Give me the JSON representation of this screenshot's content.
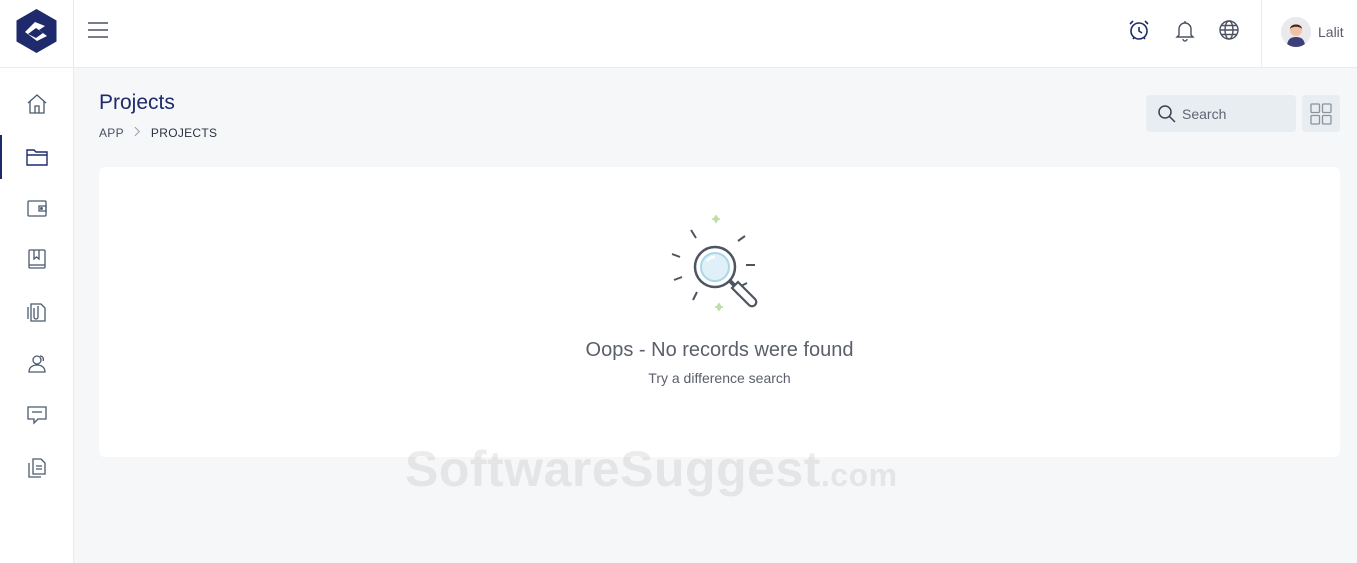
{
  "sidebar": {
    "items": [
      {
        "name": "home",
        "icon": "home-icon",
        "active": false
      },
      {
        "name": "projects",
        "icon": "folder-icon",
        "active": true
      },
      {
        "name": "wallet",
        "icon": "wallet-icon",
        "active": false
      },
      {
        "name": "bookmarks",
        "icon": "book-icon",
        "active": false
      },
      {
        "name": "documents",
        "icon": "clip-document-icon",
        "active": false
      },
      {
        "name": "users",
        "icon": "users-icon",
        "active": false
      },
      {
        "name": "messages",
        "icon": "chat-icon",
        "active": false
      },
      {
        "name": "files",
        "icon": "files-icon",
        "active": false
      }
    ]
  },
  "header": {
    "icons": [
      "alarm-clock-icon",
      "bell-icon",
      "globe-icon"
    ],
    "user_name": "Lalit"
  },
  "page": {
    "title": "Projects",
    "breadcrumb": [
      "APP",
      "PROJECTS"
    ]
  },
  "search": {
    "placeholder": "Search"
  },
  "empty_state": {
    "title": "Oops - No records were found",
    "subtitle": "Try a difference search"
  },
  "watermark": {
    "main": "SoftwareSuggest",
    "suffix": ".com"
  },
  "colors": {
    "brand": "#1e2a6b",
    "background": "#f5f7f9",
    "card": "#ffffff",
    "search_bg": "#e8edf1"
  }
}
